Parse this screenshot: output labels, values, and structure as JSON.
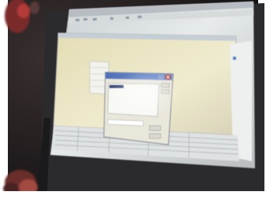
{
  "scene": {
    "subject": "photo-of-monitor-showing-desktop-application",
    "colors": {
      "frame": "#ffffff",
      "room_dark": "#1f1b1b",
      "bezel": "#2b2a2d",
      "screen_glow": "#dde2e3",
      "app_window": "#e7e3c9",
      "titlebar": "#5b7fc6",
      "dialog": "#e9e6da",
      "accent_red": "#b53a37"
    },
    "icons": [
      "monitor-bezel",
      "application-window",
      "dialog-window",
      "close-button-icon"
    ]
  }
}
